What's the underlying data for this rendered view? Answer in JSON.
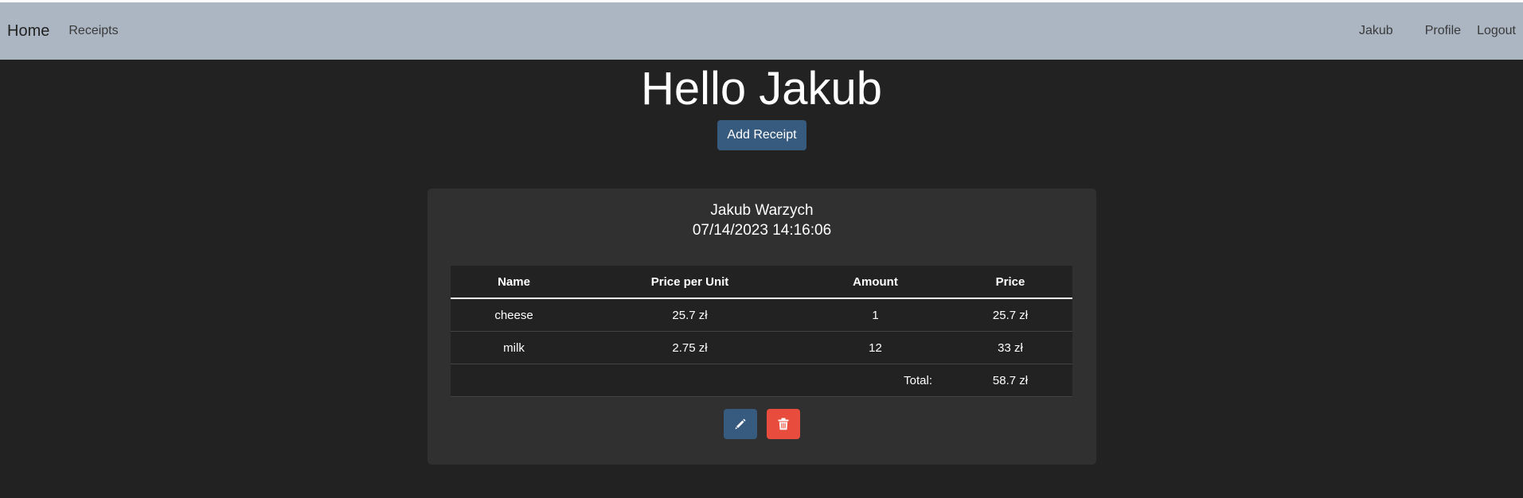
{
  "nav": {
    "brand": "Home",
    "receipts": "Receipts",
    "user": "Jakub",
    "profile": "Profile",
    "logout": "Logout"
  },
  "greeting": "Hello Jakub",
  "add_receipt": "Add Receipt",
  "receipt": {
    "owner": "Jakub Warzych",
    "date": "07/14/2023 14:16:06",
    "headers": [
      "Name",
      "Price per Unit",
      "Amount",
      "Price"
    ],
    "items": [
      {
        "name": "cheese",
        "price_per_unit": "25.7 zł",
        "amount": "1",
        "price": "25.7 zł"
      },
      {
        "name": "milk",
        "price_per_unit": "2.75 zł",
        "amount": "12",
        "price": "33 zł"
      }
    ],
    "total_label": "Total:",
    "total": "58.7 zł"
  },
  "icons": {
    "edit": "pencil-icon",
    "delete": "trash-icon"
  },
  "colors": {
    "navbar": "#abb6c2",
    "background": "#222222",
    "card": "#303030",
    "primary": "#375a7f",
    "danger": "#e74c3c"
  }
}
